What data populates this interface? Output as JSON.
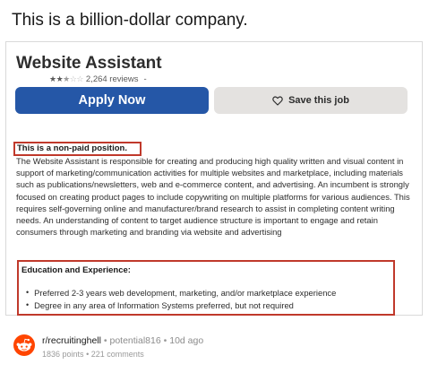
{
  "caption": "This is a billion-dollar company.",
  "job": {
    "title": "Website Assistant",
    "rating_stars": 2.5,
    "reviews": "2,264 reviews",
    "reviews_suffix": "-",
    "apply_label": "Apply Now",
    "save_label": "Save this job",
    "apply_color": "#2557a7",
    "save_color": "#e4e2e0"
  },
  "description": {
    "nonpaid": "This is a non-paid position.",
    "body": "The Website Assistant is responsible for creating and producing high quality written and visual content in support of marketing/communication activities for multiple websites and marketplace, including materials such as publications/newsletters, web and e-commerce content, and advertising. An incumbent is strongly focused on creating product pages to include copywriting on multiple platforms for various audiences. This requires self-governing online and manufacturer/brand research to assist in completing content writing needs. An understanding of content to target audience structure is important to engage and retain consumers through marketing and branding via website and advertising",
    "highlight_color": "#c0392b"
  },
  "education": {
    "title": "Education and Experience:",
    "items": [
      "Preferred 2-3 years web development, marketing, and/or marketplace experience",
      "Degree in any area of Information Systems preferred, but not required"
    ]
  },
  "footer": {
    "subreddit": "r/recruitinghell",
    "separator": "•",
    "user": "potential816",
    "age": "10d ago",
    "points": "1836 points",
    "comments": "221 comments",
    "icon": "reddit-icon",
    "icon_color": "#ff4500"
  }
}
